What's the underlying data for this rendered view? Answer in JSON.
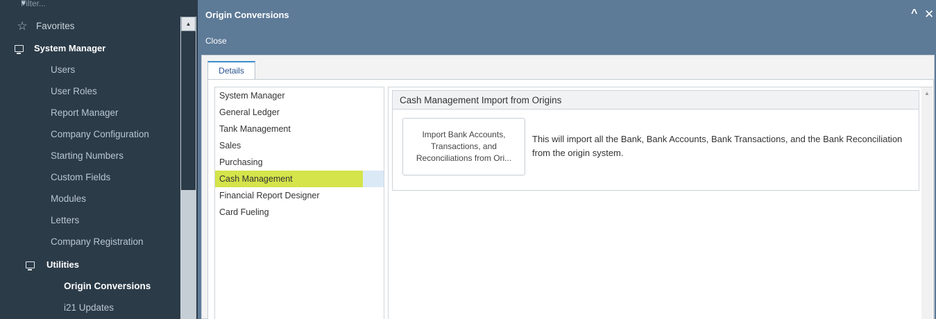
{
  "nav": {
    "filter_placeholder": "Filter...",
    "favorites": "Favorites",
    "system_manager": "System Manager",
    "items": [
      "Users",
      "User Roles",
      "Report Manager",
      "Company Configuration",
      "Starting Numbers",
      "Custom Fields",
      "Modules",
      "Letters",
      "Company Registration"
    ],
    "utilities": "Utilities",
    "utility_items": [
      "Origin Conversions",
      "i21 Updates"
    ],
    "active_item": "Origin Conversions"
  },
  "window": {
    "title": "Origin Conversions",
    "toolbar_close": "Close",
    "tab": "Details"
  },
  "modules": [
    "System Manager",
    "General Ledger",
    "Tank Management",
    "Sales",
    "Purchasing",
    "Cash Management",
    "Financial Report Designer",
    "Card Fueling"
  ],
  "selected_module": "Cash Management",
  "group": {
    "title": "Cash Management Import from Origins",
    "button_label": "Import Bank Accounts, Transactions, and Reconciliations from Ori...",
    "description": "This will import all the Bank, Bank Accounts, Bank Transactions, and the Bank Reconciliation from the origin system."
  },
  "colors": {
    "nav_bg": "#2b3b48",
    "window_header": "#5d7a97",
    "selection_highlight": "#d4e44a",
    "tab_accent": "#3a8ecb"
  }
}
